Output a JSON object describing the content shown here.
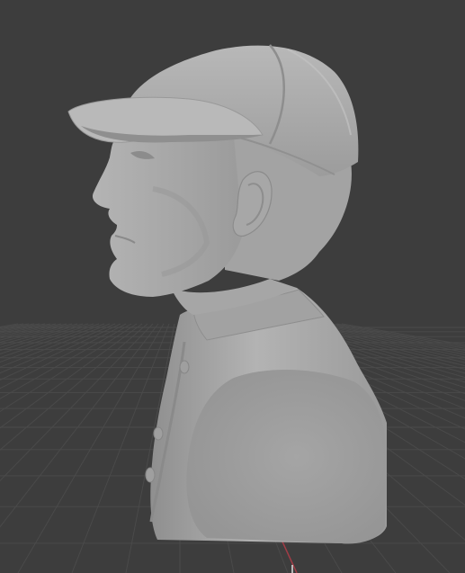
{
  "viewport": {
    "background": "#3d3d3d",
    "grid_color": "#4a4a4a",
    "x_axis_color": "#a13c46",
    "model": {
      "name": "bust-with-baseball-cap",
      "material_color": "#a9a9a9"
    }
  }
}
